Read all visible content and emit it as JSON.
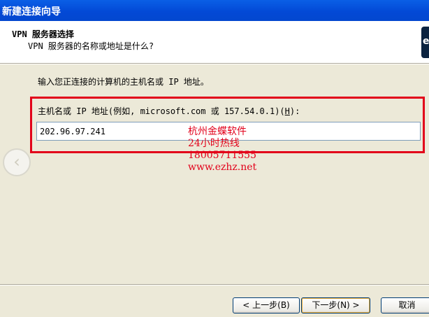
{
  "window": {
    "title": "新建连接向导"
  },
  "header": {
    "title": "VPN 服务器选择",
    "subtitle": "VPN 服务器的名称或地址是什么?"
  },
  "main": {
    "instruction": "输入您正连接的计算机的主机名或 IP 地址。",
    "field_label_prefix": "主机名或 IP 地址(例如, microsoft.com 或 157.54.0.1)(",
    "field_label_accel": "H",
    "field_label_suffix": "):",
    "host_value": "202.96.97.241"
  },
  "watermark": {
    "line1": "杭州金蝶软件",
    "line2": "24小时热线",
    "line3": "18005711555",
    "line4": "www.ezhz.net"
  },
  "buttons": {
    "back": "< 上一步(B)",
    "next": "下一步(N) >",
    "cancel": "取消"
  },
  "colors": {
    "titlebar": "#0349d6",
    "highlight": "#e2001a",
    "dialog_bg": "#ece9d8"
  }
}
